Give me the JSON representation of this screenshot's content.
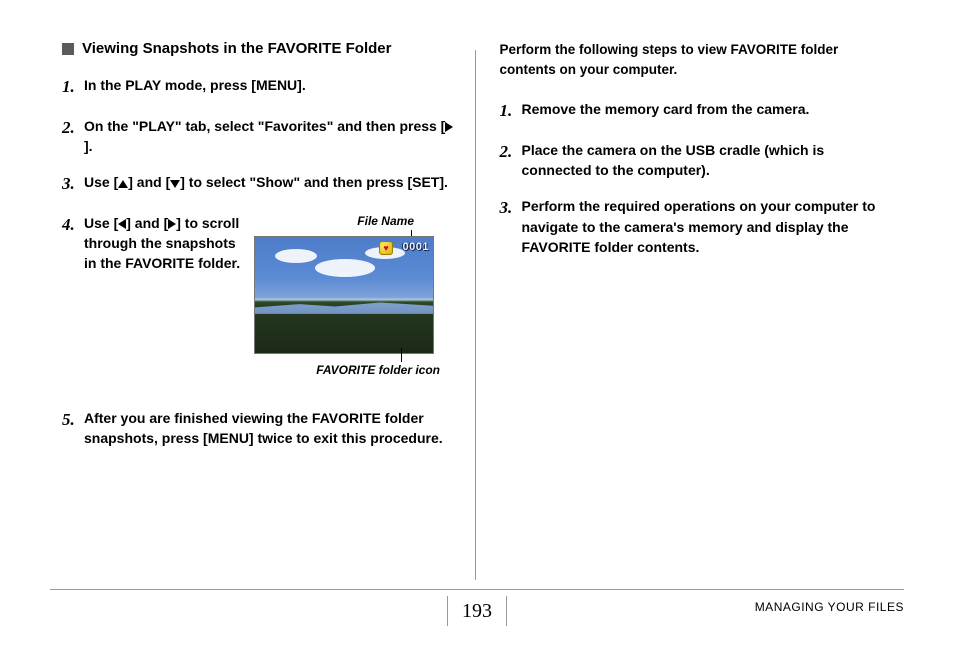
{
  "left": {
    "heading": "Viewing Snapshots in the FAVORITE Folder",
    "steps": {
      "s1": "In the PLAY mode, press [MENU].",
      "s2a": "On the \"PLAY\" tab, select \"Favorites\" and then press [",
      "s2b": "].",
      "s3a": "Use [",
      "s3b": "] and [",
      "s3c": "] to select \"Show\" and then press [SET].",
      "s4a": "Use [",
      "s4b": "] and [",
      "s4c": "] to scroll through the snapshots in the FAVORITE folder.",
      "s5": "After you are finished viewing the FAVORITE folder snapshots, press [MENU] twice to exit this procedure."
    },
    "figure": {
      "caption_top": "File Name",
      "caption_bottom": "FAVORITE folder icon",
      "file_number": "0001"
    }
  },
  "right": {
    "intro": "Perform the following steps to view FAVORITE folder contents on your computer.",
    "steps": {
      "s1": "Remove the memory card from the camera.",
      "s2": "Place the camera on the USB cradle (which is connected to the computer).",
      "s3": "Perform the required operations on your computer to navigate to the camera's memory and display the FAVORITE folder contents."
    }
  },
  "footer": {
    "page": "193",
    "section": "MANAGING YOUR FILES"
  },
  "nums": {
    "n1": "1.",
    "n2": "2.",
    "n3": "3.",
    "n4": "4.",
    "n5": "5."
  }
}
